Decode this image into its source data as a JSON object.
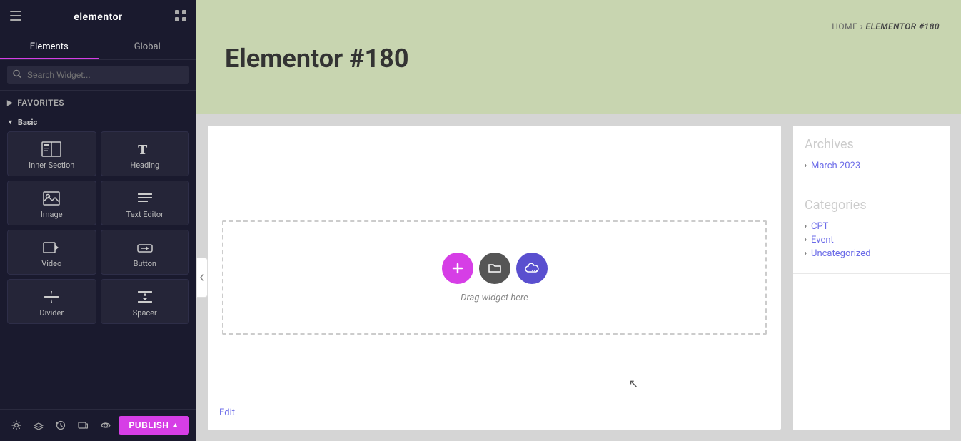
{
  "sidebar": {
    "title": "elementor",
    "tabs": [
      {
        "id": "elements",
        "label": "Elements",
        "active": true
      },
      {
        "id": "global",
        "label": "Global",
        "active": false
      }
    ],
    "search_placeholder": "Search Widget...",
    "favorites_label": "Favorites",
    "basic_label": "Basic",
    "widgets": [
      {
        "id": "inner-section",
        "label": "Inner Section",
        "icon": "inner-section-icon"
      },
      {
        "id": "heading",
        "label": "Heading",
        "icon": "heading-icon"
      },
      {
        "id": "image",
        "label": "Image",
        "icon": "image-icon"
      },
      {
        "id": "text-editor",
        "label": "Text Editor",
        "icon": "text-editor-icon"
      },
      {
        "id": "video",
        "label": "Video",
        "icon": "video-icon"
      },
      {
        "id": "button",
        "label": "Button",
        "icon": "button-icon"
      },
      {
        "id": "divider",
        "label": "Divider",
        "icon": "divider-icon"
      },
      {
        "id": "spacer",
        "label": "Spacer",
        "icon": "spacer-icon"
      }
    ],
    "footer_icons": [
      "settings-icon",
      "layers-icon",
      "history-icon",
      "responsive-icon",
      "preview-icon",
      "view-icon"
    ],
    "publish_label": "PUBLISH"
  },
  "page": {
    "title": "Elementor #180",
    "breadcrumb_home": "HOME",
    "breadcrumb_current": "ELEMENTOR #180"
  },
  "canvas": {
    "drop_label": "Drag widget here",
    "edit_link": "Edit"
  },
  "right_sidebar": {
    "archives": {
      "title": "Archives",
      "items": [
        {
          "label": "March 2023"
        }
      ]
    },
    "categories": {
      "title": "Categories",
      "items": [
        {
          "label": "CPT"
        },
        {
          "label": "Event"
        },
        {
          "label": "Uncategorized"
        }
      ]
    }
  },
  "colors": {
    "accent": "#d63ee6",
    "link_blue": "#6c6ce8",
    "dark_sidebar": "#1a1a2e",
    "banner_bg": "#c8d5b0"
  }
}
